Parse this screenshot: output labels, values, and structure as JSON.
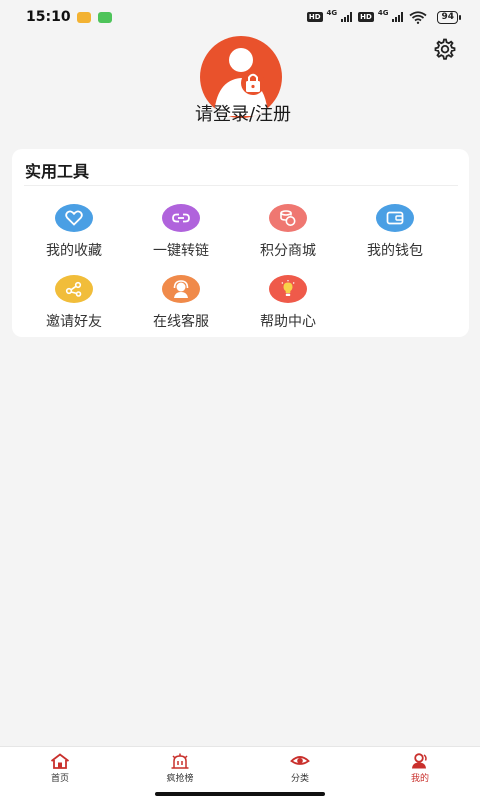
{
  "status_bar": {
    "time": "15:10",
    "sim1": "HD",
    "net1": "4G",
    "sim2": "HD",
    "net2": "4G",
    "battery": "94"
  },
  "header": {
    "login_text": "请登录/注册",
    "avatar_color": "#e9522c"
  },
  "tools": {
    "title": "实用工具",
    "items": [
      {
        "label": "我的收藏",
        "icon": "heart-icon",
        "color": "#4a9fe4"
      },
      {
        "label": "一键转链",
        "icon": "link-icon",
        "color": "#b063dc"
      },
      {
        "label": "积分商城",
        "icon": "coins-icon",
        "color": "#ef7771"
      },
      {
        "label": "我的钱包",
        "icon": "wallet-icon",
        "color": "#4a9fe4"
      },
      {
        "label": "邀请好友",
        "icon": "share-icon",
        "color": "#f1bd3a"
      },
      {
        "label": "在线客服",
        "icon": "customer-service-icon",
        "color": "#f08a4a"
      },
      {
        "label": "帮助中心",
        "icon": "lightbulb-icon",
        "color": "#ef5a4a"
      }
    ]
  },
  "bottom_nav": {
    "items": [
      {
        "label": "首页",
        "icon": "home-icon"
      },
      {
        "label": "疯抢榜",
        "icon": "ranking-icon"
      },
      {
        "label": "分类",
        "icon": "eye-icon"
      },
      {
        "label": "我的",
        "icon": "user-icon"
      }
    ],
    "active_color": "#c9302c"
  }
}
